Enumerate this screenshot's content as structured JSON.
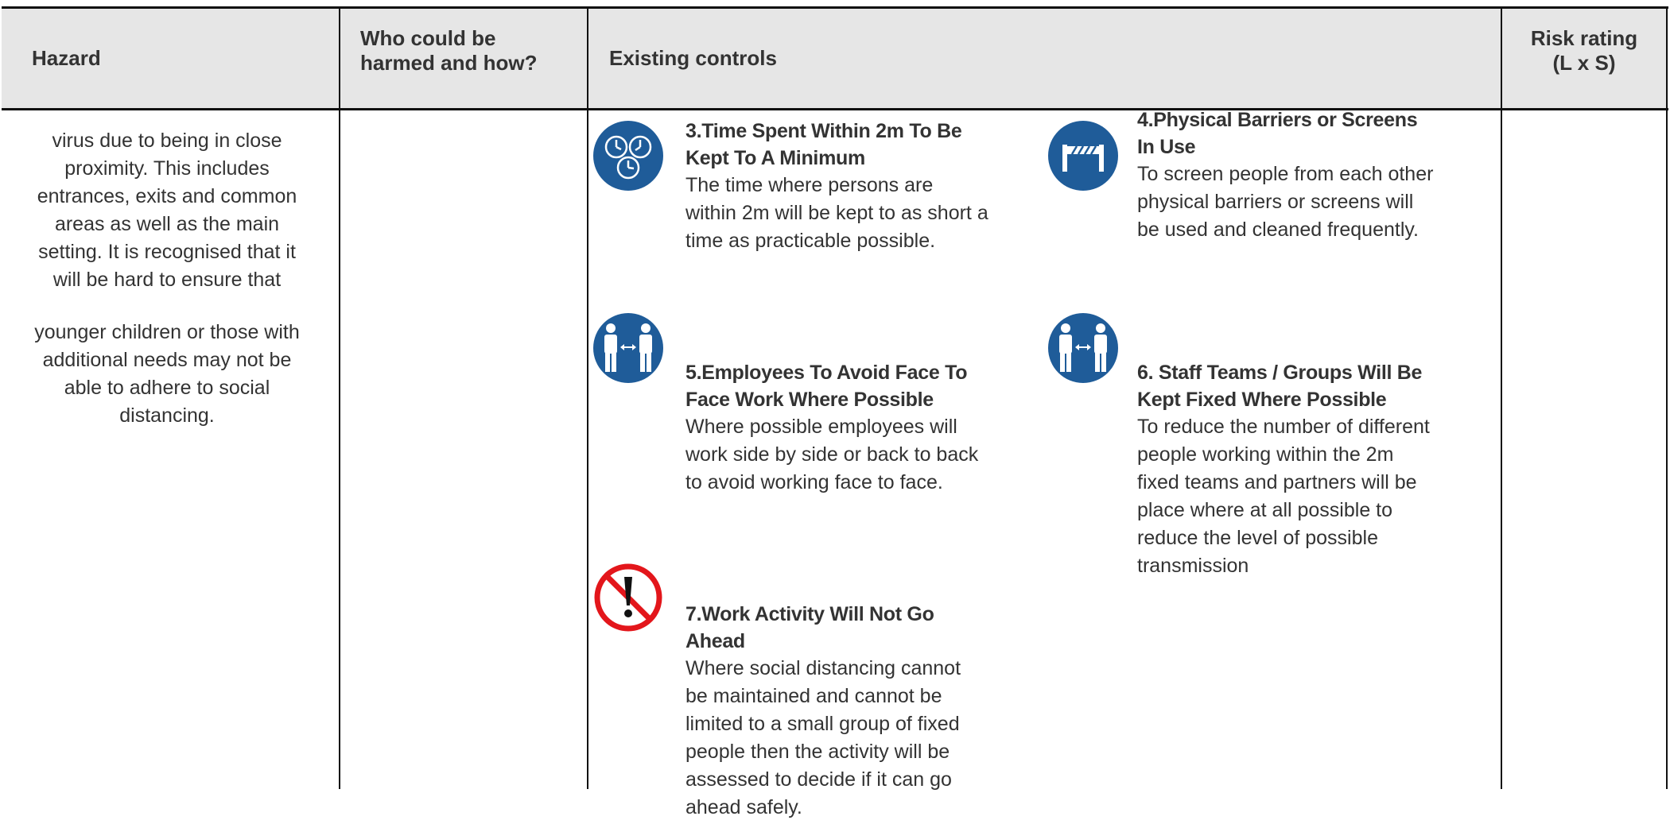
{
  "table": {
    "headers": {
      "hazard": "Hazard",
      "who_line1": "Who could be",
      "who_line2": "harmed and how?",
      "existing_controls": "Existing controls",
      "risk_line1": "Risk rating",
      "risk_line2": "(L x S)"
    },
    "hazard_text": {
      "para1": [
        "virus due to being in close",
        "proximity. This includes",
        "entrances, exits and common",
        "areas as well as the main",
        "setting. It is recognised that it",
        "will be hard to ensure that"
      ],
      "para2": [
        "younger children or those with",
        "additional needs may not be",
        "able to adhere to social",
        "distancing."
      ]
    },
    "controls": [
      {
        "icon": "clocks-icon",
        "title": [
          "3.Time Spent Within 2m To Be",
          "Kept To A Minimum"
        ],
        "body": [
          "The time where persons are",
          "within 2m will be kept to as short a",
          "time as practicable possible."
        ]
      },
      {
        "icon": "barrier-icon",
        "title": [
          "4.Physical Barriers or Screens",
          "In Use"
        ],
        "body": [
          "To screen people from each other",
          "physical barriers or screens will",
          "be used and cleaned frequently."
        ]
      },
      {
        "icon": "distancing-people-icon",
        "title": [
          "5.Employees To Avoid Face To",
          "Face Work Where Possible"
        ],
        "body": [
          "Where possible employees will",
          "work side by side or back to back",
          "to avoid working face to face."
        ]
      },
      {
        "icon": "distancing-people-icon",
        "title": [
          "6. Staff Teams / Groups Will Be",
          "Kept Fixed Where Possible"
        ],
        "body": [
          "To reduce the number of different",
          "people working within the 2m",
          "fixed teams and partners will be",
          "place where at all possible to",
          "reduce the level of possible",
          "transmission"
        ]
      },
      {
        "icon": "prohibition-exclamation-icon",
        "title": [
          "7.Work Activity Will Not Go",
          "Ahead"
        ],
        "body": [
          "Where social distancing cannot",
          "be maintained and cannot be",
          "limited to a small group of fixed",
          "people then the activity will be",
          "assessed to decide if it can go",
          "ahead safely."
        ]
      }
    ],
    "colors": {
      "icon_blue": "#1f5c99",
      "prohibition_red": "#e3161b",
      "header_bg": "#e6e6e6",
      "text": "#333333"
    }
  }
}
